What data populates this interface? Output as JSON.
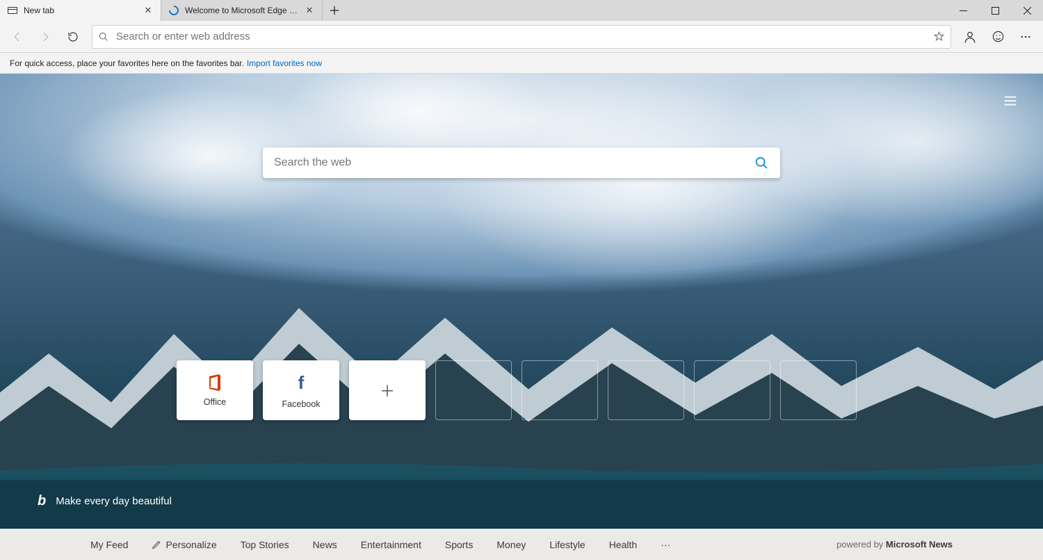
{
  "tabs": [
    {
      "title": "New tab",
      "active": true
    },
    {
      "title": "Welcome to Microsoft Edge Dev",
      "active": false
    }
  ],
  "omnibox": {
    "placeholder": "Search or enter web address"
  },
  "favbar": {
    "text": "For quick access, place your favorites here on the favorites bar.",
    "link": "Import favorites now"
  },
  "websearch": {
    "placeholder": "Search the web"
  },
  "tiles": {
    "office": "Office",
    "facebook": "Facebook"
  },
  "bing_tagline": "Make every day beautiful",
  "newsbar": {
    "items": [
      "My Feed",
      "Personalize",
      "Top Stories",
      "News",
      "Entertainment",
      "Sports",
      "Money",
      "Lifestyle",
      "Health"
    ],
    "more": "···",
    "powered_prefix": "powered by ",
    "powered_brand": "Microsoft News"
  }
}
